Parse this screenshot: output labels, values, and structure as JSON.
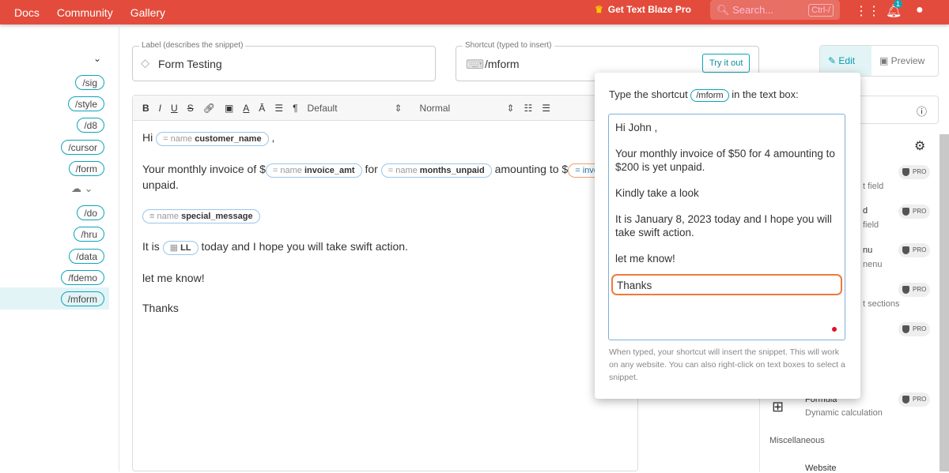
{
  "topbar": {
    "nav": [
      "Docs",
      "Community",
      "Gallery"
    ],
    "pro": "Get Text Blaze Pro",
    "search_placeholder": "Search...",
    "search_key": "Ctrl-/",
    "notif_count": "1"
  },
  "sidebar": {
    "items": [
      "/sig",
      "/style",
      "/d8",
      "/cursor",
      "/form",
      "/do",
      "/hru",
      "/data",
      "/fdemo",
      "/mform"
    ],
    "selected": "/mform"
  },
  "label_field": {
    "label": "Label (describes the snippet)",
    "value": "Form Testing"
  },
  "shortcut_field": {
    "label": "Shortcut (typed to insert)",
    "value": "/mform",
    "try": "Try it out"
  },
  "mode": {
    "edit": "Edit",
    "preview": "Preview"
  },
  "toolbar": {
    "font": "Default",
    "size": "Normal"
  },
  "editor": {
    "hi": "Hi",
    "comma": ",",
    "line2a": "Your monthly invoice of $",
    "for": "for",
    "amount": "amounting to $",
    "unpaid": "unpaid.",
    "name": "name",
    "f1": "customer_name",
    "f2": "invoice_amt",
    "f3": "months_unpaid",
    "f4": "invoi",
    "f5": "special_message",
    "itis": "It is",
    "date": "LL",
    "today": "today and I hope you will take swift action.",
    "letme": "let me know!",
    "thanks": "Thanks"
  },
  "popup": {
    "pre": "Type the shortcut",
    "shortcut": "/mform",
    "post": "in the text box:",
    "lines": [
      "Hi John ,",
      "Your monthly invoice of $50 for 4 amounting to $200 is yet unpaid.",
      "Kindly take a look",
      "It is January 8, 2023 today and I hope you will take swift action.",
      "let me know!"
    ],
    "thanks": "Thanks",
    "help": "When typed, your shortcut will insert the snippet. This will work on any website. You can also right-click on text boxes to select a snippet."
  },
  "right": {
    "pro": "PRO",
    "partials": [
      "t field",
      "d",
      "field",
      "nu",
      "nenu",
      "t sections",
      "Formula",
      "Dynamic calculation",
      "Miscellaneous",
      "Website"
    ]
  }
}
